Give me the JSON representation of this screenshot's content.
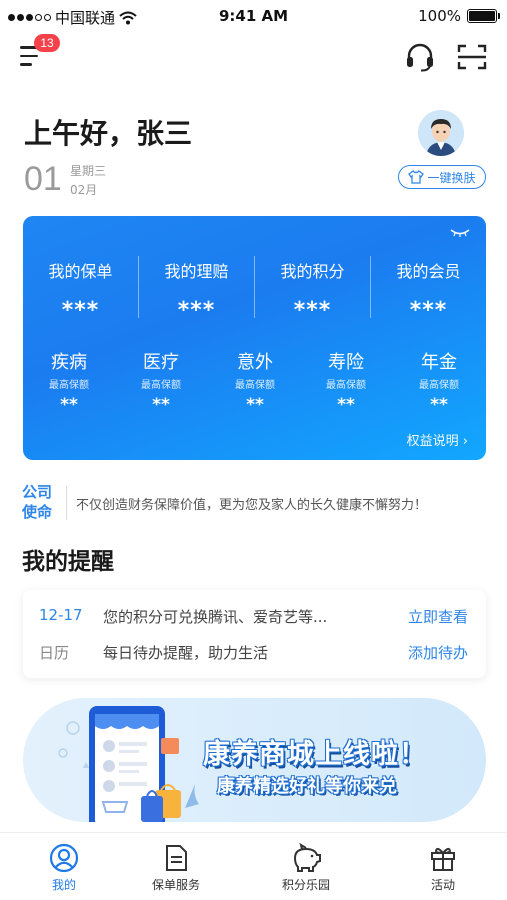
{
  "status_bar": {
    "carrier": "中国联通",
    "time": "9:41 AM",
    "battery": "100%"
  },
  "header": {
    "notification_count": "13"
  },
  "greeting": {
    "text": "上午好，张三",
    "day": "01",
    "weekday": "星期三",
    "month": "02月",
    "skin_button": "一键换肤"
  },
  "summary_card": {
    "stats": [
      {
        "label": "我的保单",
        "value": "***"
      },
      {
        "label": "我的理赔",
        "value": "***"
      },
      {
        "label": "我的积分",
        "value": "***"
      },
      {
        "label": "我的会员",
        "value": "***"
      }
    ],
    "coverage": [
      {
        "name": "疾病",
        "sub": "最高保额",
        "value": "**"
      },
      {
        "name": "医疗",
        "sub": "最高保额",
        "value": "**"
      },
      {
        "name": "意外",
        "sub": "最高保额",
        "value": "**"
      },
      {
        "name": "寿险",
        "sub": "最高保额",
        "value": "**"
      },
      {
        "name": "年金",
        "sub": "最高保额",
        "value": "**"
      }
    ],
    "rights_link": "权益说明"
  },
  "mission": {
    "tag_line1": "公司",
    "tag_line2": "使命",
    "text": "不仅创造财务保障价值，更为您及家人的长久健康不懈努力！"
  },
  "reminders": {
    "title": "我的提醒",
    "rows": [
      {
        "key": "12-17",
        "text": "您的积分可兑换腾讯、爱奇艺等...",
        "action": "立即查看"
      },
      {
        "key": "日历",
        "text": "每日待办提醒，助力生活",
        "action": "添加待办"
      }
    ]
  },
  "banner": {
    "title": "康养商城上线啦！",
    "subtitle": "康养精选好礼等你来兑"
  },
  "tabs": [
    {
      "label": "我的",
      "icon": "person-icon"
    },
    {
      "label": "保单服务",
      "icon": "document-icon"
    },
    {
      "label": "积分乐园",
      "icon": "piggy-bank-icon"
    },
    {
      "label": "活动",
      "icon": "gift-icon"
    }
  ],
  "colors": {
    "brand_blue": "#1f86f2",
    "accent_red": "#f5424a",
    "text_dark": "#1a1a1a"
  }
}
